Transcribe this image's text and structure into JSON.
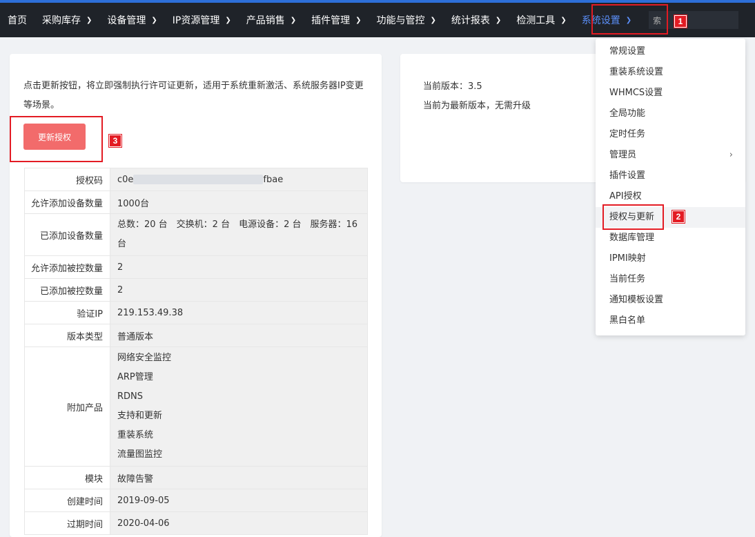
{
  "nav": {
    "items": [
      {
        "label": "首页",
        "chevron": false
      },
      {
        "label": "采购库存",
        "chevron": true
      },
      {
        "label": "设备管理",
        "chevron": true
      },
      {
        "label": "IP资源管理",
        "chevron": true
      },
      {
        "label": "产品销售",
        "chevron": true
      },
      {
        "label": "插件管理",
        "chevron": true
      },
      {
        "label": "功能与管控",
        "chevron": true
      },
      {
        "label": "统计报表",
        "chevron": true
      },
      {
        "label": "检测工具",
        "chevron": true
      },
      {
        "label": "系统设置",
        "chevron": true
      }
    ],
    "search_value": "索"
  },
  "annotations": {
    "badge1": "1",
    "badge2": "2",
    "badge3": "3"
  },
  "license": {
    "description": "点击更新按钮，将立即强制执行许可证更新，适用于系统重新激活、系统服务器IP变更等场景。",
    "update_button": "更新授权",
    "rows": [
      {
        "key": "授权码",
        "value_prefix": "c0e",
        "value_suffix": "fbae"
      },
      {
        "key": "允许添加设备数量",
        "value": "1000台"
      },
      {
        "key": "已添加设备数量",
        "value": "总数：20 台　交换机：2 台　电源设备：2 台　服务器：16 台"
      },
      {
        "key": "允许添加被控数量",
        "value": "2"
      },
      {
        "key": "已添加被控数量",
        "value": "2"
      },
      {
        "key": "验证IP",
        "value": "219.153.49.38"
      },
      {
        "key": "版本类型",
        "value": "普通版本"
      },
      {
        "key": "附加产品",
        "values": [
          "网络安全监控",
          "ARP管理",
          "RDNS",
          "支持和更新",
          "重装系统",
          "流量图监控"
        ]
      },
      {
        "key": "模块",
        "value": "故障告警"
      },
      {
        "key": "创建时间",
        "value": "2019-09-05"
      },
      {
        "key": "过期时间",
        "value": "2020-04-06"
      }
    ]
  },
  "version": {
    "current": "当前版本：3.5",
    "status": "当前为最新版本，无需升级"
  },
  "dropdown": {
    "items": [
      {
        "label": "常规设置"
      },
      {
        "label": "重装系统设置"
      },
      {
        "label": "WHMCS设置"
      },
      {
        "label": "全局功能"
      },
      {
        "label": "定时任务"
      },
      {
        "label": "管理员",
        "submenu": true
      },
      {
        "label": "插件设置"
      },
      {
        "label": "API授权"
      },
      {
        "label": "授权与更新",
        "hover": true
      },
      {
        "label": "数据库管理"
      },
      {
        "label": "IPMI映射"
      },
      {
        "label": "当前任务"
      },
      {
        "label": "通知模板设置"
      },
      {
        "label": "黑白名单"
      }
    ]
  },
  "colors": {
    "nav_bg": "#1f2329",
    "accent": "#5b8ff9",
    "update_button": "#f26b6b",
    "annotation": "#e31b23"
  }
}
